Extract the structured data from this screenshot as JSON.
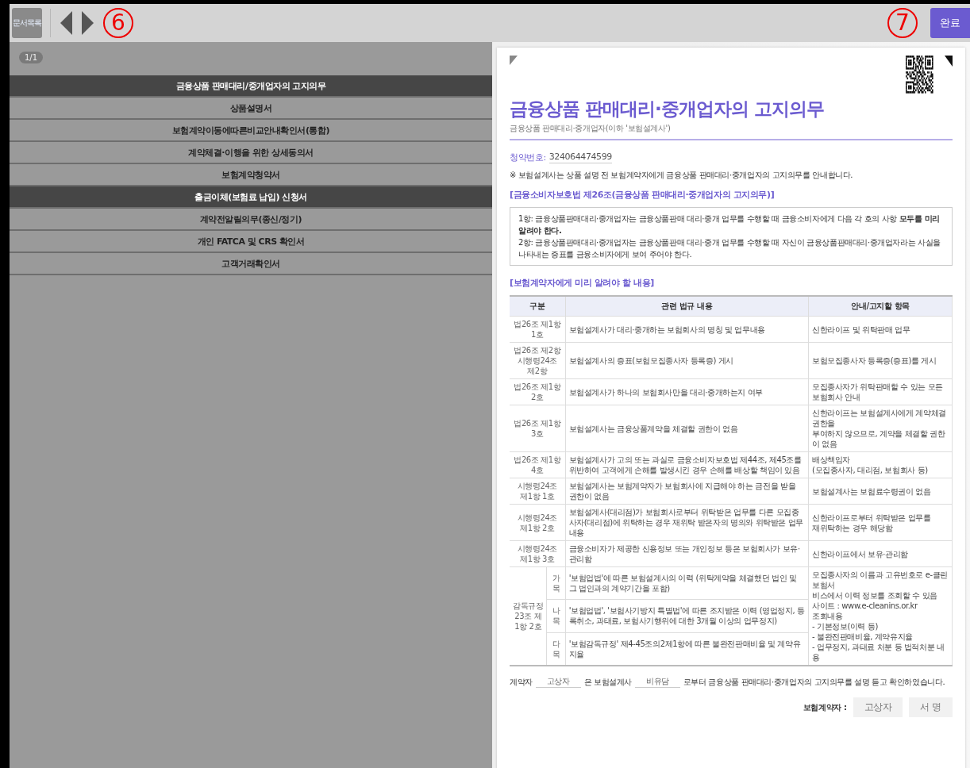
{
  "toolbar": {
    "doc_list_button": "문서목록",
    "left_marker": "6",
    "right_marker": "7",
    "done_button": "완료"
  },
  "doc_menu": {
    "page_badge": "1/1",
    "items": [
      {
        "label": "금융상품 판매대리/중개업자의 고지의무",
        "selected": true
      },
      {
        "label": "상품설명서",
        "selected": false
      },
      {
        "label": "보험계약이동에따른비교안내확인서(통합)",
        "selected": false
      },
      {
        "label": "계약체결·이행을 위한 상세동의서",
        "selected": false
      },
      {
        "label": "보험계약청약서",
        "selected": false
      },
      {
        "label": "출금이체(보험료 납입) 신청서",
        "selected": true
      },
      {
        "label": "계약전알릴의무(종신/정기)",
        "selected": false
      },
      {
        "label": "개인 FATCA 및 CRS 확인서",
        "selected": false
      },
      {
        "label": "고객거래확인서",
        "selected": false
      }
    ]
  },
  "document": {
    "title": "금융상품 판매대리·중개업자의 고지의무",
    "subtitle": "금융상품 판매대리·중개업자(이하 '보험설계사')",
    "number_label": "청약번호:",
    "number": "324064474599",
    "intro": "※ 보험설계사는 상품 설명 전 보험계약자에게 금융상품 판매대리·중개업자의 고지의무를 안내합니다.",
    "law_heading": "[금융소비자보호법 제26조(금융상품 판매대리·중개업자의 고지의무)]",
    "law_items": [
      "1항: 금융상품판매대리·중개업자는 금융상품판매 대리·중개 업무를 수행할 때 금융소비자에게 다음 각 호의 사항 **모두를 미리 알려야 한다.**",
      "2항: 금융상품판매대리·중개업자는 금융상품판매 대리·중개 업무를 수행할 때 자신이 금융상품판매대리·중개업자라는 사실을 나타내는 증표를 금융소비자에게 보여 주어야 한다."
    ],
    "table_heading": "[보험계약자에게 미리 알려야 할 내용]",
    "table": {
      "columns": [
        "구분",
        "관련 법규 내용",
        "안내/고지할 항목"
      ],
      "rows": [
        {
          "kind": "standard",
          "section": [
            "법26조 제1항 1호"
          ],
          "content": "보험설계사가 대리·중개하는 보험회사의 명칭 및 업무내용",
          "guide": [
            "신한라이프 및 위탁판매 업무"
          ]
        },
        {
          "kind": "standard",
          "section": [
            "법26조 제2항",
            "시행령24조 제2항"
          ],
          "content": "보험설계사의 증표(보험모집종사자 등록증) 게시",
          "guide": [
            "보험모집종사자 등록증(증표)를 게시"
          ]
        },
        {
          "kind": "standard",
          "section": [
            "법26조 제1항 2호"
          ],
          "content": "보험설계사가 하나의 보험회사만을 대리·중개하는지 여부",
          "guide": [
            "모집종사자가 위탁판매할 수 있는 모든",
            "보험회사 안내"
          ]
        },
        {
          "kind": "standard",
          "section": [
            "법26조 제1항 3호"
          ],
          "content": "보험설계사는 금융상품계약을 체결할 권한이 없음",
          "guide": [
            "신한라이프는 보험설계사에게 계약체결 권한을",
            "부여하지 않으므로, 계약을 체결할 권한이 없음"
          ]
        },
        {
          "kind": "standard",
          "section": [
            "법26조 제1항 4호"
          ],
          "content": "보험설계사가 고의 또는 과실로 금융소비자보호법 제44조, 제45조를 위반하여 고객에게 손해를 발생시킨 경우 손해를 배상할 책임이 있음",
          "guide": [
            "배상책임자",
            "(모집종사자, 대리점, 보험회사 등)"
          ]
        },
        {
          "kind": "standard",
          "section": [
            "시행령24조 제1항 1호"
          ],
          "content": "보험설계사는 보험계약자가 보험회사에 지급해야 하는 금전을 받을 권한이 없음",
          "guide": [
            "보험설계사는 보험료수령권이 없음"
          ]
        },
        {
          "kind": "standard",
          "section": [
            "시행령24조 제1항 2호"
          ],
          "content": "보험설계사(대리점)가 보험회사로부터 위탁받은 업무를 다른 모집종사자(대리점)에 위탁하는 경우 재위탁 받은자의 명의와 위탁받은 업무 내용",
          "guide": [
            "신한라이프로부터 위탁받은 업무를",
            "재위탁하는 경우 해당함"
          ]
        },
        {
          "kind": "standard",
          "section": [
            "시행령24조 제1항 3호"
          ],
          "content": "금융소비자가 제공한 신용정보 또는 개인정보 등은 보험회사가 보유·관리함",
          "guide": [
            "신한라이프에서 보유·관리함"
          ]
        },
        {
          "kind": "group",
          "section": [
            "감독규정",
            "23조 제1항 2호"
          ],
          "subrows": [
            {
              "item": "가목",
              "content": "'보험업법'에 따른 보험설계사의 이력 (위탁계약을 체결했던 법인 및 그 법인과의 계약기간을 포함)"
            },
            {
              "item": "나목",
              "content": "'보험업법', '보험사기방지 특별법'에 따른 조치받은 이력 (영업정지, 등록취소, 과태료, 보험사기행위에 대한 3개월 이상의 업무정지)"
            },
            {
              "item": "다목",
              "content": "'보험감독규정' 제4-45조의2제1항에 따른 불완전판매비율 및 계약유지율"
            }
          ],
          "guide": [
            "모집종사자의 이름과 고유번호로 e-클린보험서",
            "비스에서 이력 정보를 조회할 수 있음",
            "사이트 : www.e-cleanins.or.kr",
            "조회내용",
            "- 기본정보(이력 등)",
            "- 불완전판매비율, 계약유지율",
            "- 업무정지, 과태료 처분 등 법적처분 내용"
          ]
        }
      ]
    },
    "confirmation": {
      "prefix": "계약자",
      "contractor": "고상자",
      "middle": "은 보험설계사",
      "agent": "비유담",
      "suffix": "로부터 금융상품 판매대리·중개업자의 고지의무를 설명 듣고 확인하였습니다."
    },
    "signature": {
      "label": "보험계약자 :",
      "name_box": "고상자",
      "sign_box": "서 명"
    }
  }
}
